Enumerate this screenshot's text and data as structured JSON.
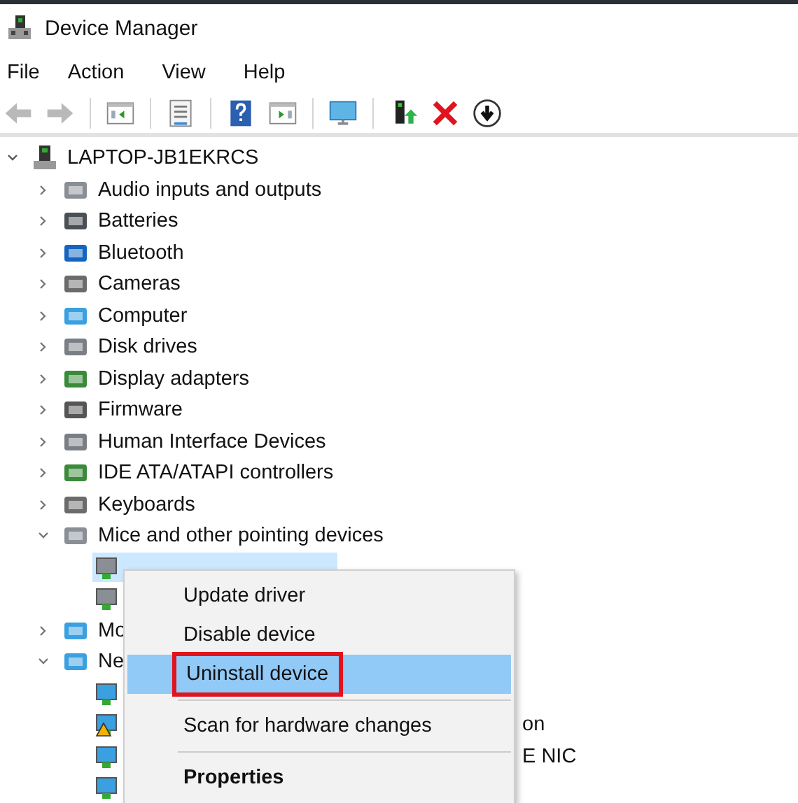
{
  "window": {
    "title": "Device Manager"
  },
  "menu_bar": [
    "File",
    "Action",
    "View",
    "Help"
  ],
  "toolbar": [
    {
      "kind": "back",
      "disabled": true
    },
    {
      "kind": "forward",
      "disabled": true
    },
    {
      "kind": "sep"
    },
    {
      "kind": "tree"
    },
    {
      "kind": "sep"
    },
    {
      "kind": "props"
    },
    {
      "kind": "sep"
    },
    {
      "kind": "help"
    },
    {
      "kind": "pane"
    },
    {
      "kind": "sep"
    },
    {
      "kind": "scan"
    },
    {
      "kind": "sep"
    },
    {
      "kind": "update"
    },
    {
      "kind": "remove"
    },
    {
      "kind": "down"
    }
  ],
  "tree": {
    "label": "LAPTOP-JB1EKRCS",
    "expanded": true,
    "children": [
      {
        "label": "Audio inputs and outputs",
        "expanded": false
      },
      {
        "label": "Batteries",
        "expanded": false
      },
      {
        "label": "Bluetooth",
        "expanded": false
      },
      {
        "label": "Cameras",
        "expanded": false
      },
      {
        "label": "Computer",
        "expanded": false
      },
      {
        "label": "Disk drives",
        "expanded": false
      },
      {
        "label": "Display adapters",
        "expanded": false
      },
      {
        "label": "Firmware",
        "expanded": false
      },
      {
        "label": "Human Interface Devices",
        "expanded": false
      },
      {
        "label": "IDE ATA/ATAPI controllers",
        "expanded": false
      },
      {
        "label": "Keyboards",
        "expanded": false
      },
      {
        "label": "Mice and other pointing devices",
        "expanded": true,
        "children": [
          {
            "selected": true
          },
          {
            "selected": false
          }
        ]
      },
      {
        "label": "Mo",
        "expanded": false
      },
      {
        "label": "Ne",
        "expanded": true,
        "children": [
          {
            "selected": false
          },
          {
            "tail": "on",
            "selected": false,
            "warning": true
          },
          {
            "tail": "E NIC",
            "selected": false
          },
          {
            "selected": false
          }
        ]
      }
    ]
  },
  "context_menu": [
    {
      "kind": "item",
      "label": "Update driver",
      "selected": false
    },
    {
      "kind": "item",
      "label": "Disable device",
      "selected": false
    },
    {
      "kind": "item",
      "label": "Uninstall device",
      "selected": true,
      "outlined": true
    },
    {
      "kind": "sep"
    },
    {
      "kind": "item",
      "label": "Scan for hardware changes",
      "selected": false
    },
    {
      "kind": "sep"
    },
    {
      "kind": "item",
      "label": "Properties",
      "selected": false,
      "default": true
    }
  ]
}
